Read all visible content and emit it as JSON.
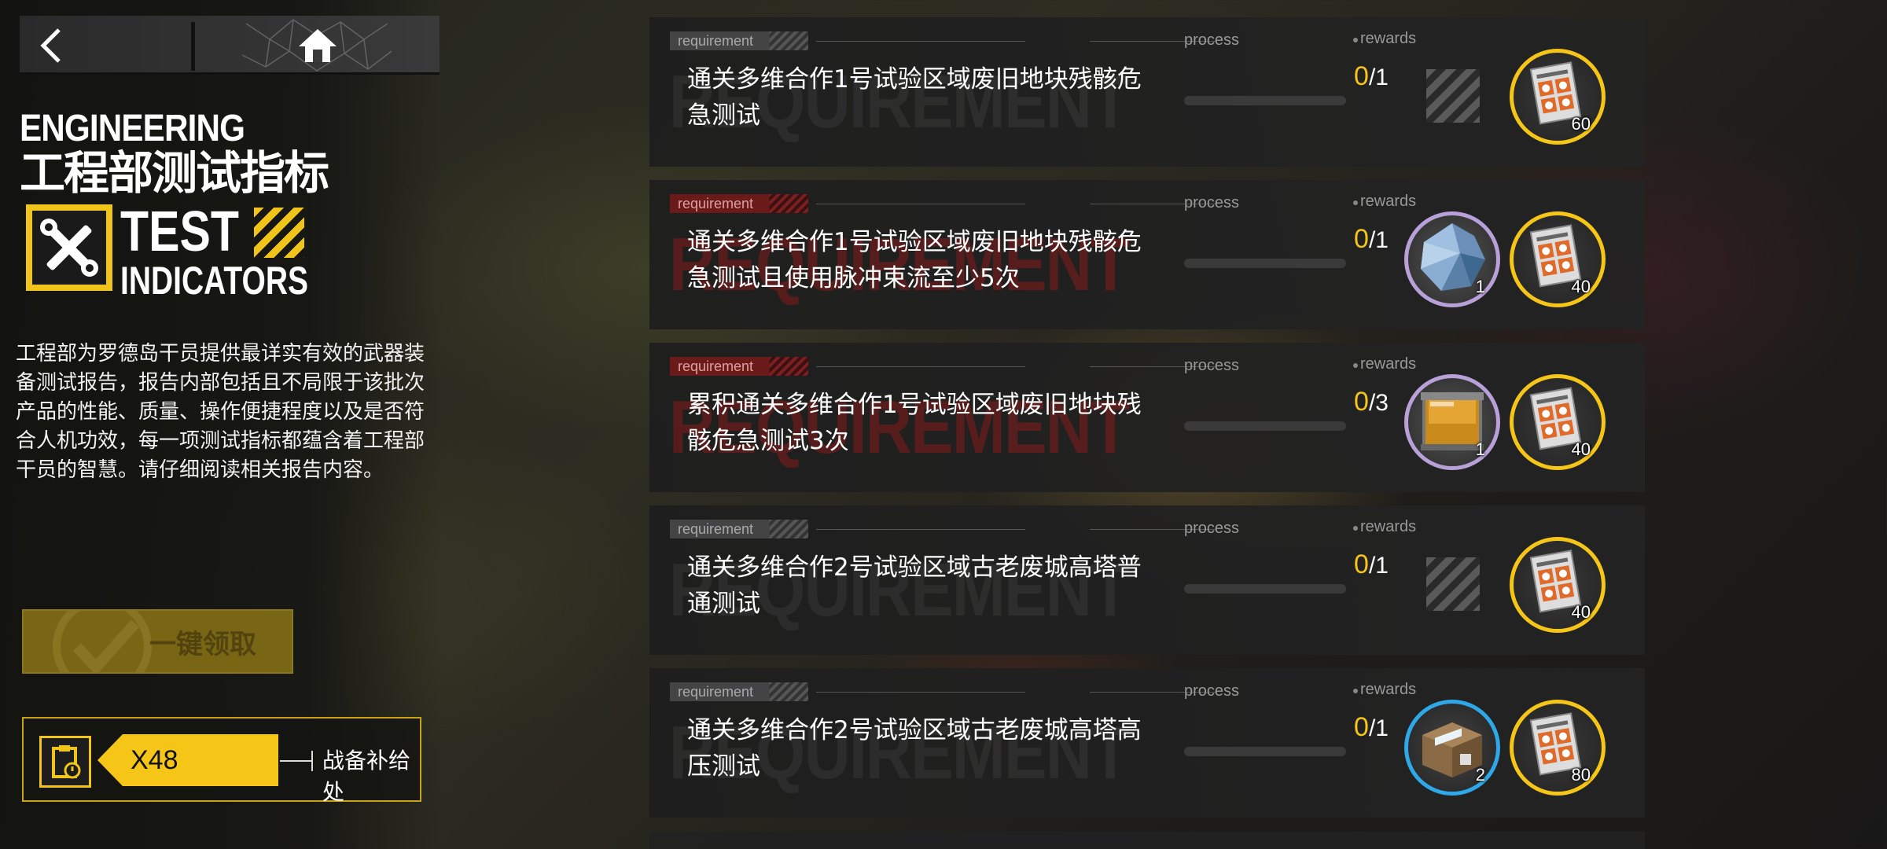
{
  "title": {
    "en_line1": "ENGINEERING",
    "cn": "工程部测试指标",
    "en_test": "TEST",
    "en_indicators": "INDICATORS"
  },
  "description": "工程部为罗德岛干员提供最详实有效的武器装备测试报告，报告内部包括且不局限于该批次产品的性能、质量、操作便捷程度以及是否符合人机功效，每一项测试指标都蕴含着工程部干员的智慧。请仔细阅读相关报告内容。",
  "claim_all_label": "一键领取",
  "supply": {
    "count": "X48",
    "label": "战备补给处"
  },
  "headers": {
    "requirement": "requirement",
    "process": "process",
    "rewards": "rewards",
    "watermark": "REQUIREMENT"
  },
  "tasks": [
    {
      "text": "通关多维合作1号试验区域废旧地块残骸危急测试",
      "current": "0",
      "total": "/1",
      "progress_fraction": 0,
      "highlight": false,
      "rewards": [
        {
          "icon": "empty-reward-slot",
          "count": ""
        },
        {
          "icon": "supply-document-icon",
          "count": "60",
          "rarity_color": "#f5c518"
        }
      ]
    },
    {
      "text": "通关多维合作1号试验区域废旧地块残骸危急测试且使用脉冲束流至少5次",
      "current": "0",
      "total": "/1",
      "progress_fraction": 0,
      "highlight": true,
      "rewards": [
        {
          "icon": "crystal-ore-icon",
          "count": "1",
          "rarity_color": "#b8a0d8"
        },
        {
          "icon": "supply-document-icon",
          "count": "40",
          "rarity_color": "#f5c518"
        }
      ]
    },
    {
      "text": "累积通关多维合作1号试验区域废旧地块残骸危急测试3次",
      "current": "0",
      "total": "/3",
      "progress_fraction": 0,
      "highlight": true,
      "rewards": [
        {
          "icon": "liquid-canister-icon",
          "count": "1",
          "rarity_color": "#b8a0d8"
        },
        {
          "icon": "supply-document-icon",
          "count": "40",
          "rarity_color": "#f5c518"
        }
      ]
    },
    {
      "text": "通关多维合作2号试验区域古老废城高塔普通测试",
      "current": "0",
      "total": "/1",
      "progress_fraction": 0,
      "highlight": false,
      "rewards": [
        {
          "icon": "empty-reward-slot",
          "count": ""
        },
        {
          "icon": "supply-document-icon",
          "count": "40",
          "rarity_color": "#f5c518"
        }
      ]
    },
    {
      "text": "通关多维合作2号试验区域古老废城高塔高压测试",
      "current": "0",
      "total": "/1",
      "progress_fraction": 0,
      "highlight": false,
      "rewards": [
        {
          "icon": "material-box-icon",
          "count": "2",
          "rarity_color": "#2ea8e8"
        },
        {
          "icon": "supply-document-icon",
          "count": "80",
          "rarity_color": "#f5c518"
        }
      ]
    }
  ],
  "colors": {
    "accent_yellow": "#f5c518",
    "highlight_red": "#6b1a1a"
  }
}
